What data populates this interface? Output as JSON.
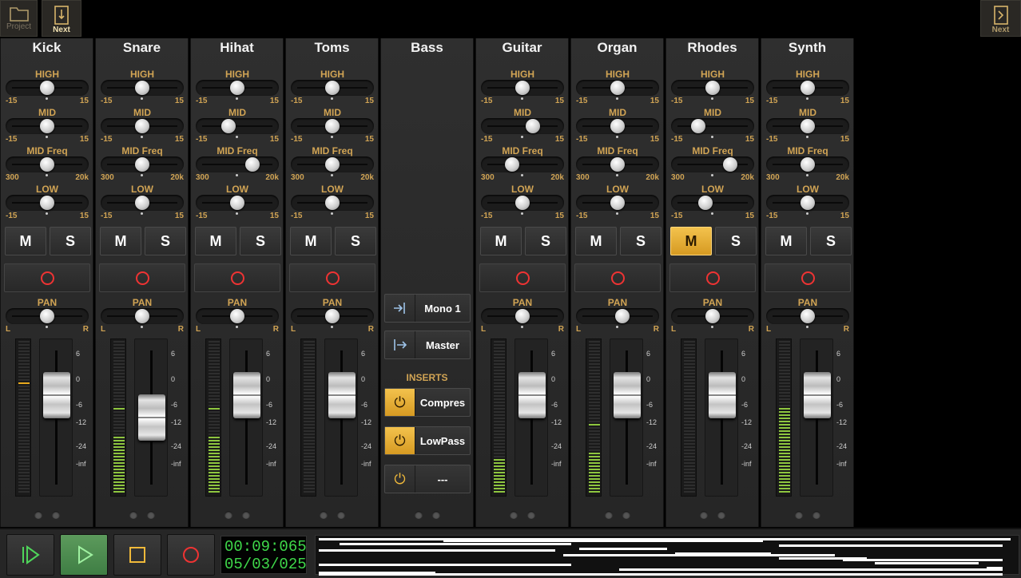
{
  "topbar": {
    "project_label": "Project",
    "next_label": "Next",
    "right_next_label": "Next",
    "icons": {
      "project": "folder-icon",
      "next": "edit-song-icon",
      "right_next": "next-screen-icon"
    }
  },
  "knob_labels": {
    "high": "HIGH",
    "mid": "MID",
    "midfreq": "MID Freq",
    "low": "LOW",
    "pan": "PAN"
  },
  "knob_ranges": {
    "gain_min": "-15",
    "gain_max": "15",
    "freq_min": "300",
    "freq_max": "20k",
    "pan_min": "L",
    "pan_max": "R"
  },
  "buttons": {
    "mute": "M",
    "solo": "S"
  },
  "fader_scale": [
    "6",
    "0",
    "-6",
    "-12",
    "-24",
    "-inf"
  ],
  "channels": [
    {
      "name": "Kick",
      "high": 0.5,
      "mid": 0.5,
      "freq": 0.5,
      "low": 0.5,
      "pan": 0.5,
      "fader": 0.78,
      "vu": 0,
      "peak": 0.72,
      "mute": false
    },
    {
      "name": "Snare",
      "high": 0.5,
      "mid": 0.5,
      "freq": 0.5,
      "low": 0.5,
      "pan": 0.5,
      "fader": 0.56,
      "vu": 0.38,
      "peak": 0.55,
      "mute": false
    },
    {
      "name": "Hihat",
      "high": 0.5,
      "mid": 0.38,
      "freq": 0.72,
      "low": 0.5,
      "pan": 0.5,
      "fader": 0.78,
      "vu": 0.38,
      "peak": 0.55,
      "mute": false
    },
    {
      "name": "Toms",
      "high": 0.5,
      "mid": 0.5,
      "freq": 0.5,
      "low": 0.5,
      "pan": 0.5,
      "fader": 0.78,
      "vu": 0,
      "peak": 0,
      "mute": false
    },
    {
      "name": "Bass",
      "is_bus": true,
      "route_in": "Mono 1",
      "route_out": "Master",
      "inserts_label": "INSERTS",
      "inserts": [
        {
          "label": "Compres",
          "on": true
        },
        {
          "label": "LowPass",
          "on": true
        },
        {
          "label": "---",
          "on": false
        }
      ]
    },
    {
      "name": "Guitar",
      "high": 0.5,
      "mid": 0.65,
      "freq": 0.35,
      "low": 0.5,
      "pan": 0.5,
      "fader": 0.78,
      "vu": 0.22,
      "peak": 0,
      "mute": false
    },
    {
      "name": "Organ",
      "high": 0.5,
      "mid": 0.5,
      "freq": 0.5,
      "low": 0.5,
      "pan": 0.57,
      "fader": 0.78,
      "vu": 0.27,
      "peak": 0.45,
      "mute": false
    },
    {
      "name": "Rhodes",
      "high": 0.5,
      "mid": 0.3,
      "freq": 0.75,
      "low": 0.4,
      "pan": 0.5,
      "fader": 0.78,
      "vu": 0,
      "peak": 0,
      "mute": true
    },
    {
      "name": "Synth",
      "high": 0.5,
      "mid": 0.5,
      "freq": 0.5,
      "low": 0.5,
      "pan": 0.5,
      "fader": 0.78,
      "vu": 0.56,
      "peak": 0,
      "mute": false
    }
  ],
  "transport": {
    "time": "00:09:065",
    "date": "05/03/025",
    "icons": [
      "rewind-to-start-icon",
      "play-icon",
      "stop-icon",
      "record-icon"
    ]
  },
  "colors": {
    "accent": "#f0b93a",
    "label": "#d1a454",
    "meter": "#8ec63f",
    "record": "#e33333",
    "clock": "#3fd84a"
  }
}
